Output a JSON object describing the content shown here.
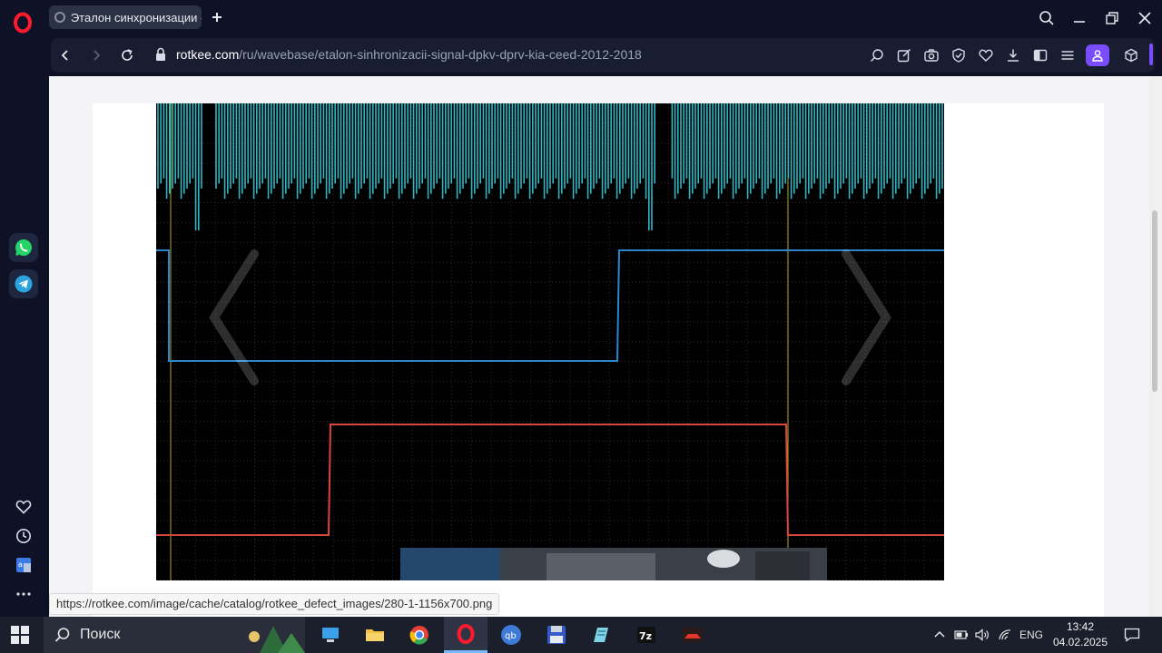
{
  "browser": {
    "tab": {
      "title": "Эталон синхронизации -"
    },
    "address": {
      "host": "rotkee.com",
      "path": "/ru/wavebase/etalon-sinhronizacii-signal-dpkv-dprv-kia-ceed-2012-2018"
    },
    "status_url": "https://rotkee.com/image/cache/catalog/rotkee_defect_images/280-1-1156x700.png"
  },
  "sidebar": {
    "apps": [
      {
        "name": "WhatsApp",
        "color": "#25d366"
      },
      {
        "name": "Telegram",
        "color": "#2aa3df"
      }
    ]
  },
  "scope": {
    "colors": {
      "channel_a": "#2fb7c4",
      "channel_b": "#2d86c9",
      "channel_c": "#d9463b",
      "cursor": "#b5a824",
      "grid": "#2b2b2b"
    }
  },
  "taskbar": {
    "search_placeholder": "Поиск",
    "tray_lang": "ENG",
    "time": "13:42",
    "date": "04.02.2025"
  }
}
